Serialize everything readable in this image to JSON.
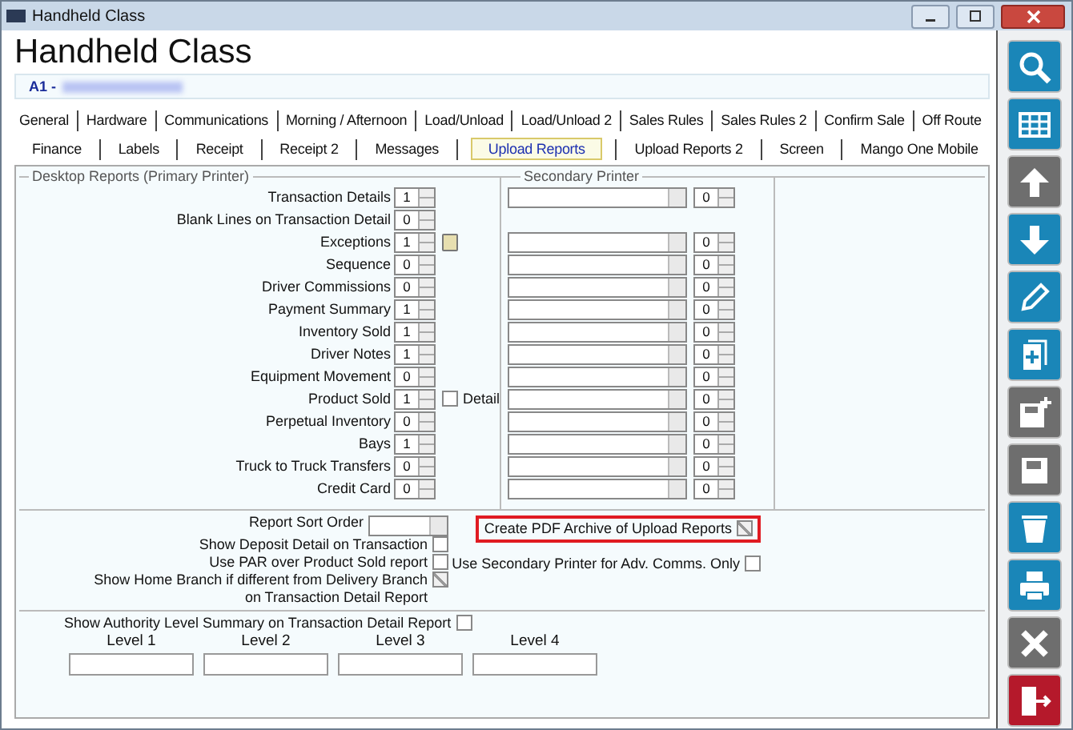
{
  "window": {
    "title": "Handheld Class"
  },
  "heading": "Handheld Class",
  "record": {
    "code": "A1 -"
  },
  "tab_rows": [
    {
      "tabs": [
        {
          "label": "General",
          "selected": false
        },
        {
          "label": "Hardware",
          "selected": false
        },
        {
          "label": "Communications",
          "selected": false
        },
        {
          "label": "Morning / Afternoon",
          "selected": false
        },
        {
          "label": "Load/Unload",
          "selected": false
        },
        {
          "label": "Load/Unload 2",
          "selected": false
        },
        {
          "label": "Sales Rules",
          "selected": false
        },
        {
          "label": "Sales Rules 2",
          "selected": false
        },
        {
          "label": "Confirm Sale",
          "selected": false
        },
        {
          "label": "Off Route",
          "selected": false
        }
      ]
    },
    {
      "tabs": [
        {
          "label": "Finance",
          "selected": false
        },
        {
          "label": "Labels",
          "selected": false
        },
        {
          "label": "Receipt",
          "selected": false
        },
        {
          "label": "Receipt 2",
          "selected": false
        },
        {
          "label": "Messages",
          "selected": false
        },
        {
          "label": "Upload Reports",
          "selected": true
        },
        {
          "label": "Upload Reports 2",
          "selected": false
        },
        {
          "label": "Screen",
          "selected": false
        },
        {
          "label": "Mango One Mobile",
          "selected": false
        }
      ]
    }
  ],
  "desktop_reports": {
    "legend": "Desktop Reports (Primary Printer)",
    "secondary_legend": "Secondary Printer",
    "rows": [
      {
        "kind": "plain",
        "label": "Transaction Details",
        "value": "1",
        "secondary_value": "0"
      },
      {
        "kind": "plain",
        "label": "Blank Lines on Transaction Detail",
        "value": "0"
      },
      {
        "kind": "with-button",
        "label": "Exceptions",
        "value": "1",
        "secondary_value": "0"
      },
      {
        "kind": "plain",
        "label": "Sequence",
        "value": "0",
        "secondary_value": "0"
      },
      {
        "kind": "plain",
        "label": "Driver Commissions",
        "value": "0",
        "secondary_value": "0"
      },
      {
        "kind": "plain",
        "label": "Payment Summary",
        "value": "1",
        "secondary_value": "0"
      },
      {
        "kind": "plain",
        "label": "Inventory Sold",
        "value": "1",
        "secondary_value": "0"
      },
      {
        "kind": "plain",
        "label": "Driver Notes",
        "value": "1",
        "secondary_value": "0"
      },
      {
        "kind": "plain",
        "label": "Equipment Movement",
        "value": "0",
        "secondary_value": "0"
      },
      {
        "kind": "with-checkbox",
        "label": "Product Sold",
        "value": "1",
        "check_label": "Detail",
        "checked": false,
        "secondary_value": "0"
      },
      {
        "kind": "plain",
        "label": "Perpetual Inventory",
        "value": "0",
        "secondary_value": "0"
      },
      {
        "kind": "plain",
        "label": "Bays",
        "value": "1",
        "secondary_value": "0"
      },
      {
        "kind": "plain",
        "label": "Truck to Truck Transfers",
        "value": "0",
        "secondary_value": "0"
      },
      {
        "kind": "plain",
        "label": "Credit Card",
        "value": "0",
        "secondary_value": "0"
      }
    ]
  },
  "options": {
    "sort_label": "Report Sort Order",
    "left_checks": [
      {
        "label": "Show Deposit Detail on Transaction",
        "checked": false
      },
      {
        "label": "Use PAR over Product Sold report",
        "checked": false
      },
      {
        "label": "Show Home Branch if different from Delivery Branch\non Transaction Detail Report",
        "checked": true
      }
    ],
    "right_checks": [
      {
        "label": "Create PDF Archive of Upload Reports",
        "checked": true,
        "highlighted": true
      },
      {
        "label": "Use Secondary Printer for Adv. Comms. Only",
        "checked": false,
        "highlighted": false
      }
    ]
  },
  "authority": {
    "label": "Show Authority Level Summary on Transaction Detail Report",
    "checked": false,
    "levels": [
      "Level 1",
      "Level 2",
      "Level 3",
      "Level 4"
    ]
  },
  "toolbar": [
    {
      "kind": "search",
      "enabled": true
    },
    {
      "kind": "grid",
      "enabled": true
    },
    {
      "kind": "up",
      "enabled": false
    },
    {
      "kind": "down",
      "enabled": true
    },
    {
      "kind": "edit",
      "enabled": true
    },
    {
      "kind": "new",
      "enabled": true
    },
    {
      "kind": "save-new",
      "enabled": false
    },
    {
      "kind": "save",
      "enabled": false
    },
    {
      "kind": "delete",
      "enabled": true
    },
    {
      "kind": "print",
      "enabled": true
    },
    {
      "kind": "cancel",
      "enabled": false
    },
    {
      "kind": "exit",
      "enabled": true
    }
  ]
}
